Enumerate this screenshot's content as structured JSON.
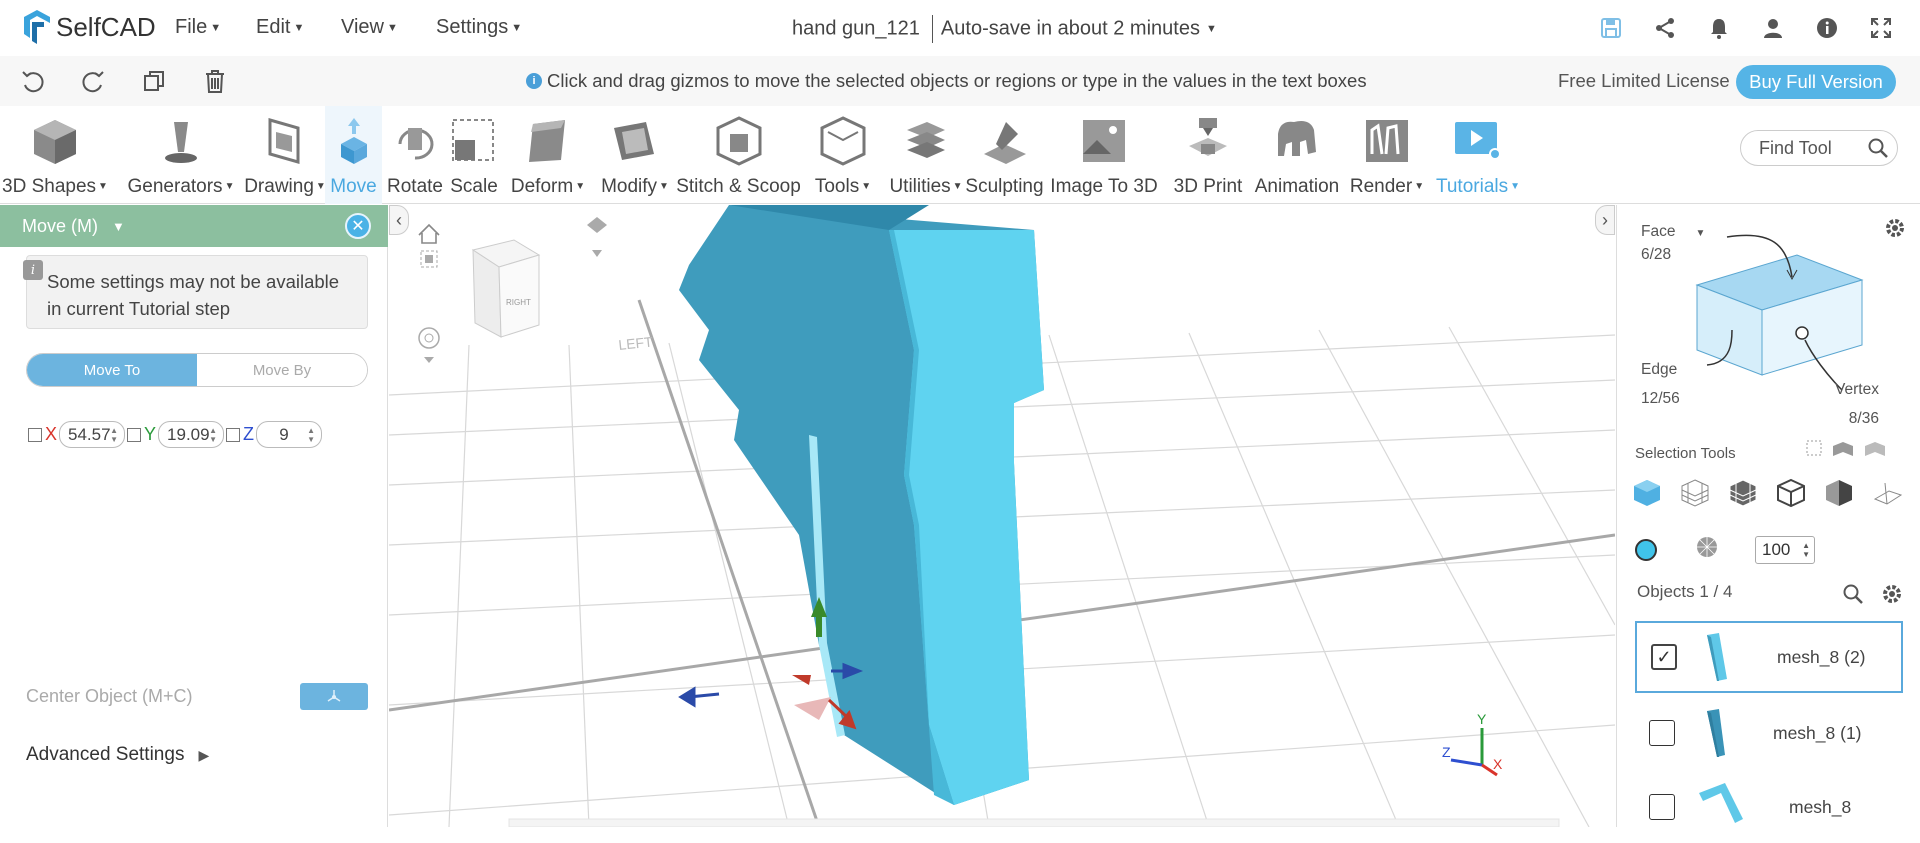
{
  "app": {
    "name": "SelfCAD",
    "brand_color": "#3aa3dc"
  },
  "menubar": {
    "file": "File",
    "edit": "Edit",
    "view": "View",
    "settings": "Settings"
  },
  "document": {
    "name": "hand gun_121",
    "autosave": "Auto-save in about 2 minutes"
  },
  "hint": "Click and drag gizmos to move the selected objects or regions or type in the values in the text boxes",
  "license": {
    "text": "Free Limited License",
    "buy_label": "Buy Full Version"
  },
  "tools": [
    {
      "label": "3D Shapes",
      "dropdown": true,
      "icon": "cube-icon"
    },
    {
      "label": "Generators",
      "dropdown": true,
      "icon": "generator-icon"
    },
    {
      "label": "Drawing",
      "dropdown": true,
      "icon": "drawing-icon"
    },
    {
      "label": "Move",
      "dropdown": false,
      "icon": "move-icon",
      "active": true
    },
    {
      "label": "Rotate",
      "dropdown": false,
      "icon": "rotate-icon"
    },
    {
      "label": "Scale",
      "dropdown": false,
      "icon": "scale-icon"
    },
    {
      "label": "Deform",
      "dropdown": true,
      "icon": "deform-icon"
    },
    {
      "label": "Modify",
      "dropdown": true,
      "icon": "modify-icon"
    },
    {
      "label": "Stitch & Scoop",
      "dropdown": false,
      "icon": "stitch-icon"
    },
    {
      "label": "Tools",
      "dropdown": true,
      "icon": "tools-icon"
    },
    {
      "label": "Utilities",
      "dropdown": true,
      "icon": "utilities-icon"
    },
    {
      "label": "Sculpting",
      "dropdown": false,
      "icon": "sculpting-icon"
    },
    {
      "label": "Image To 3D",
      "dropdown": false,
      "icon": "image-to-3d-icon"
    },
    {
      "label": "3D Print",
      "dropdown": false,
      "icon": "printer-icon"
    },
    {
      "label": "Animation",
      "dropdown": false,
      "icon": "animation-icon"
    },
    {
      "label": "Render",
      "dropdown": true,
      "icon": "render-icon"
    },
    {
      "label": "Tutorials",
      "dropdown": true,
      "icon": "tutorials-icon"
    }
  ],
  "find_tool": {
    "placeholder": "Find Tool"
  },
  "move_panel": {
    "title": "Move (M)",
    "notice": "Some settings may not be available in current Tutorial step",
    "mode_to": "Move To",
    "mode_by": "Move By",
    "x_label": "X",
    "x_value": "54.57",
    "y_label": "Y",
    "y_value": "19.09",
    "z_label": "Z",
    "z_value": "9",
    "center_label": "Center Object (M+C)",
    "advanced_label": "Advanced Settings"
  },
  "viewcube": {
    "face_text": "RIGHT",
    "floor_text": "LEFT"
  },
  "axes": {
    "x": "X",
    "y": "Y",
    "z": "Z"
  },
  "selection": {
    "mode": "Face",
    "face_count": "6/28",
    "edge_label": "Edge",
    "edge_count": "12/56",
    "vertex_label": "Vertex",
    "vertex_count": "8/36",
    "tools_label": "Selection Tools",
    "opacity_value": "100"
  },
  "objects": {
    "header": "Objects 1 / 4",
    "items": [
      {
        "name": "mesh_8 (2)",
        "checked": true
      },
      {
        "name": "mesh_8 (1)",
        "checked": false
      },
      {
        "name": "mesh_8",
        "checked": false
      }
    ]
  }
}
